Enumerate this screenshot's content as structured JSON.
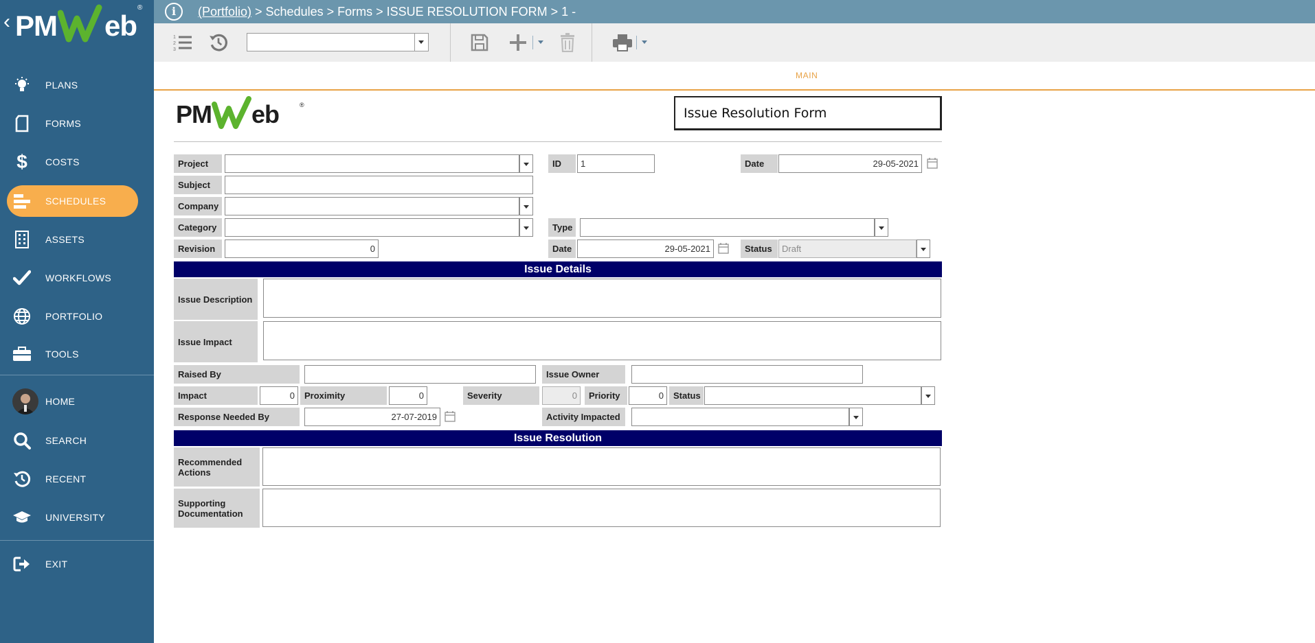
{
  "sidebar": {
    "logo_text_left": "PM",
    "logo_text_right": "eb",
    "logo_reg": "®",
    "items": [
      {
        "label": "PLANS",
        "icon": "lightbulb-icon"
      },
      {
        "label": "FORMS",
        "icon": "document-icon"
      },
      {
        "label": "COSTS",
        "icon": "dollar-icon"
      },
      {
        "label": "SCHEDULES",
        "icon": "gantt-icon",
        "active": true
      },
      {
        "label": "ASSETS",
        "icon": "building-icon"
      },
      {
        "label": "WORKFLOWS",
        "icon": "checkmark-icon"
      },
      {
        "label": "PORTFOLIO",
        "icon": "globe-icon"
      },
      {
        "label": "TOOLS",
        "icon": "toolbox-icon"
      },
      {
        "label": "HOME",
        "icon": "user-avatar"
      },
      {
        "label": "SEARCH",
        "icon": "search-icon"
      },
      {
        "label": "RECENT",
        "icon": "history-icon"
      },
      {
        "label": "UNIVERSITY",
        "icon": "graduation-cap-icon"
      },
      {
        "label": "EXIT",
        "icon": "exit-icon"
      }
    ]
  },
  "breadcrumb": {
    "portfolio_link": "(Portfolio)",
    "rest": " > Schedules > Forms > ISSUE RESOLUTION FORM > 1 -"
  },
  "toolbar": {
    "select_value": ""
  },
  "tabs": {
    "main": "MAIN"
  },
  "form": {
    "logo_text_left": "PM",
    "logo_text_right": "eb",
    "logo_reg": "®",
    "title": "Issue Resolution Form",
    "fields": {
      "project": {
        "label": "Project",
        "value": ""
      },
      "id": {
        "label": "ID",
        "value": "1"
      },
      "date": {
        "label": "Date",
        "value": "29-05-2021"
      },
      "subject": {
        "label": "Subject",
        "value": ""
      },
      "company": {
        "label": "Company",
        "value": ""
      },
      "category": {
        "label": "Category",
        "value": ""
      },
      "type": {
        "label": "Type",
        "value": ""
      },
      "revision": {
        "label": "Revision",
        "value": "0"
      },
      "rev_date": {
        "label": "Date",
        "value": "29-05-2021"
      },
      "status": {
        "label": "Status",
        "value": "Draft"
      }
    },
    "issue_details": {
      "heading": "Issue Details",
      "issue_description": {
        "label": "Issue Description",
        "value": ""
      },
      "issue_impact": {
        "label": "Issue Impact",
        "value": ""
      },
      "raised_by": {
        "label": "Raised By",
        "value": ""
      },
      "issue_owner": {
        "label": "Issue Owner",
        "value": ""
      },
      "impact": {
        "label": "Impact",
        "value": "0"
      },
      "proximity": {
        "label": "Proximity",
        "value": "0"
      },
      "severity": {
        "label": "Severity",
        "value": "0"
      },
      "priority": {
        "label": "Priority",
        "value": "0"
      },
      "status": {
        "label": "Status",
        "value": ""
      },
      "response_needed_by": {
        "label": "Response Needed By",
        "value": "27-07-2019"
      },
      "activity_impacted": {
        "label": "Activity Impacted",
        "value": ""
      }
    },
    "issue_resolution": {
      "heading": "Issue Resolution",
      "recommended_actions": {
        "label_line1": "Recommended",
        "label_line2": "Actions",
        "value": ""
      },
      "supporting_documentation": {
        "label_line1": "Supporting",
        "label_line2": "Documentation",
        "value": ""
      }
    }
  },
  "colors": {
    "sidebar_bg": "#2e6287",
    "active_nav": "#f8ae4d",
    "breadcrumb_bg": "#6b96ad",
    "section_band": "#000068",
    "tab_accent": "#e8a245",
    "logo_green": "#5cb32e"
  }
}
